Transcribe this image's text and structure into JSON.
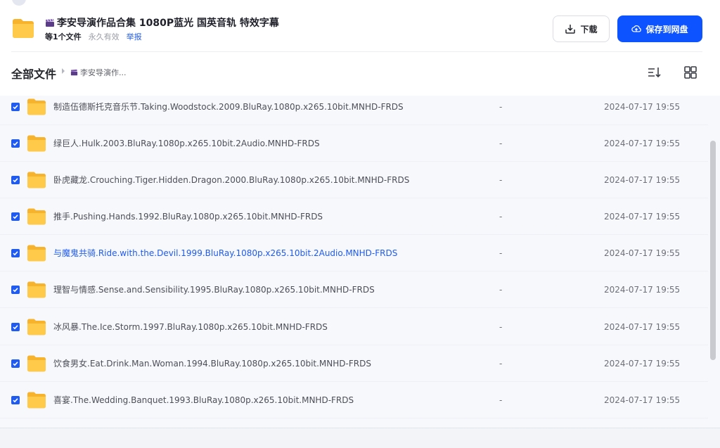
{
  "share": {
    "title": "李安导演作品合集 1080P蓝光 国英音轨 特效字幕",
    "file_count": "等1个文件",
    "validity": "永久有效",
    "report_label": "举报",
    "download_label": "下载",
    "save_label": "保存到网盘"
  },
  "breadcrumb": {
    "root": "全部文件",
    "current": "李安导演作..."
  },
  "files": [
    {
      "name": "制造伍德斯托克音乐节.Taking.Woodstock.2009.BluRay.1080p.x265.10bit.MNHD-FRDS",
      "size": "-",
      "date": "2024-07-17 19:55"
    },
    {
      "name": "绿巨人.Hulk.2003.BluRay.1080p.x265.10bit.2Audio.MNHD-FRDS",
      "size": "-",
      "date": "2024-07-17 19:55"
    },
    {
      "name": "卧虎藏龙.Crouching.Tiger.Hidden.Dragon.2000.BluRay.1080p.x265.10bit.MNHD-FRDS",
      "size": "-",
      "date": "2024-07-17 19:55"
    },
    {
      "name": "推手.Pushing.Hands.1992.BluRay.1080p.x265.10bit.MNHD-FRDS",
      "size": "-",
      "date": "2024-07-17 19:55"
    },
    {
      "name": "与魔鬼共骑.Ride.with.the.Devil.1999.BluRay.1080p.x265.10bit.2Audio.MNHD-FRDS",
      "size": "-",
      "date": "2024-07-17 19:55"
    },
    {
      "name": "理智与情感.Sense.and.Sensibility.1995.BluRay.1080p.x265.10bit.MNHD-FRDS",
      "size": "-",
      "date": "2024-07-17 19:55"
    },
    {
      "name": "冰风暴.The.Ice.Storm.1997.BluRay.1080p.x265.10bit.MNHD-FRDS",
      "size": "-",
      "date": "2024-07-17 19:55"
    },
    {
      "name": "饮食男女.Eat.Drink.Man.Woman.1994.BluRay.1080p.x265.10bit.MNHD-FRDS",
      "size": "-",
      "date": "2024-07-17 19:55"
    },
    {
      "name": "喜宴.The.Wedding.Banquet.1993.BluRay.1080p.x265.10bit.MNHD-FRDS",
      "size": "-",
      "date": "2024-07-17 19:55"
    }
  ],
  "icons": {
    "folder": "folder-icon",
    "clapper": "clapperboard-icon",
    "download": "download-icon",
    "cloud": "cloud-upload-icon",
    "sort": "sort-icon",
    "grid": "grid-view-icon",
    "check": "checkbox-checked-icon"
  },
  "colors": {
    "accent": "#0d53ff",
    "link": "#1f5bf0",
    "folder": "#ffc53d"
  }
}
